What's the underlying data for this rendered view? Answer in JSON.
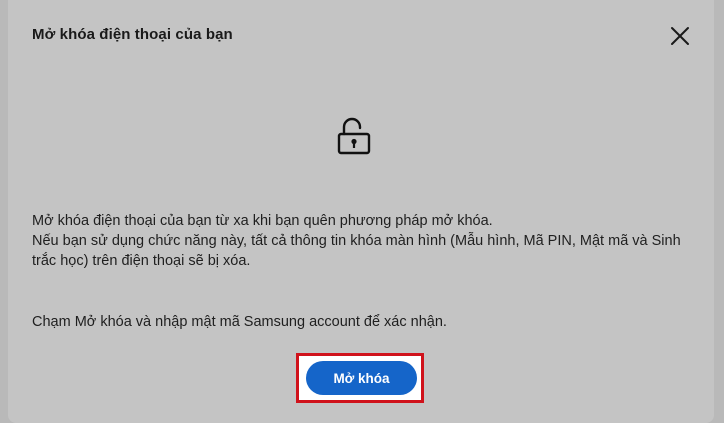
{
  "dialog": {
    "title": "Mở khóa điện thoại của bạn",
    "icons": {
      "close": "close-icon",
      "lock": "unlocked-padlock-icon"
    },
    "description_line_1": "Mở khóa điện thoại của bạn từ xa khi bạn quên phương pháp mở khóa.",
    "description_line_2": "Nếu bạn sử dụng chức năng này, tất cả thông tin khóa màn hình (Mẫu hình, Mã PIN, Mật mã và Sinh trắc học) trên điện thoại sẽ bị xóa.",
    "confirm_instruction": "Chạm Mở khóa và nhập mật mã Samsung account để xác nhận.",
    "unlock_button_label": "Mở khóa"
  },
  "colors": {
    "accent": "#1565c9",
    "highlight": "#d0121b",
    "overlay": "#c4c4c4"
  }
}
